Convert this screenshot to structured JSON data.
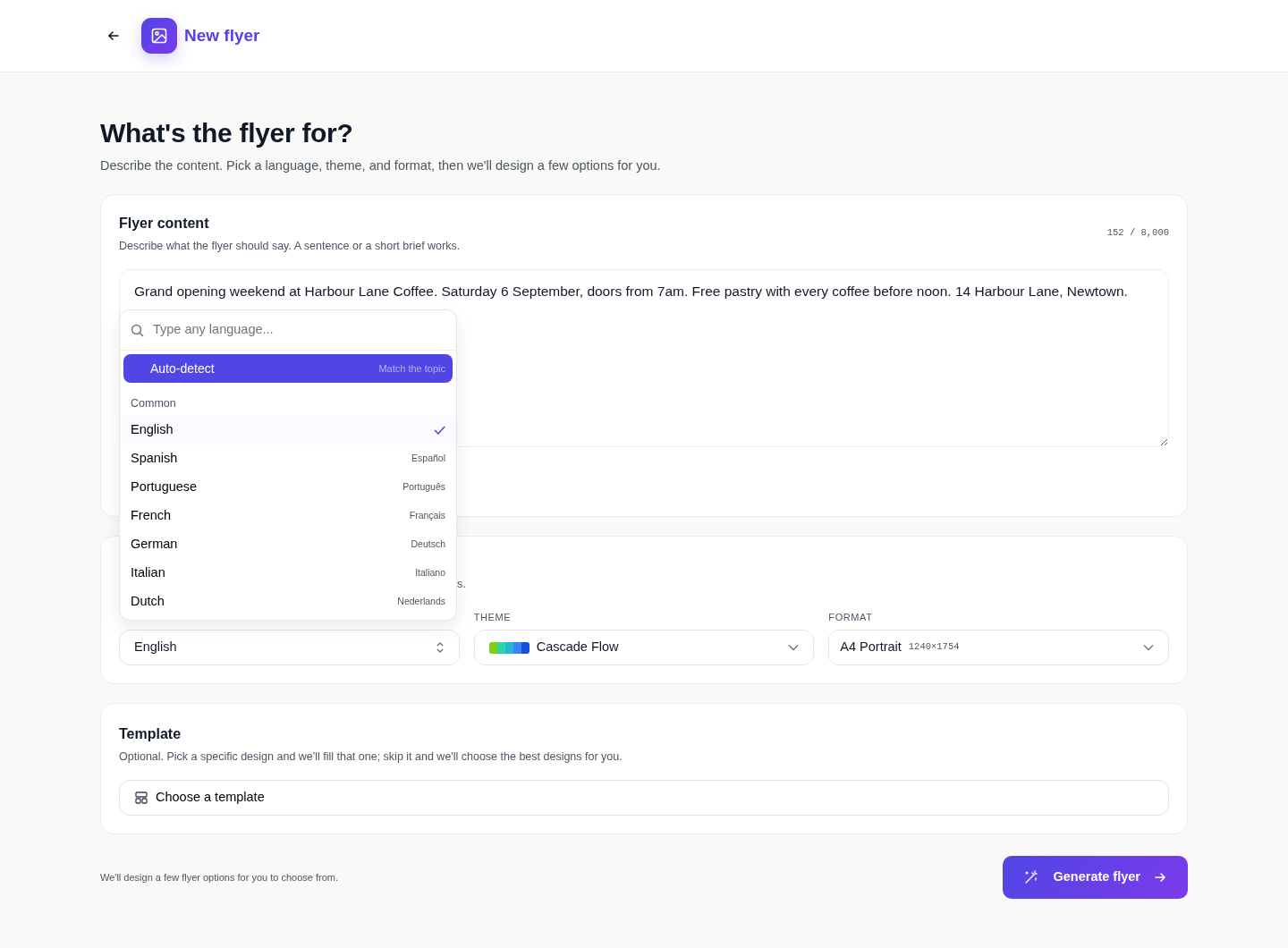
{
  "header": {
    "title": "New flyer"
  },
  "page": {
    "title": "What's the flyer for?",
    "subtitle": "Describe the content. Pick a language, theme, and format, then we'll design a few options for you."
  },
  "content_card": {
    "title": "Flyer content",
    "description": "Describe what the flyer should say. A sentence or a short brief works.",
    "counter": "152 / 8,000",
    "text": "Grand opening weekend at Harbour Lane Coffee. Saturday 6 September, doors from 7am. Free pastry with every coffee before noon. 14 Harbour Lane, Newtown."
  },
  "settings_card": {
    "description_fragment": "s.",
    "language": {
      "value": "English"
    },
    "theme": {
      "label": "THEME",
      "value": "Cascade Flow",
      "swatch": [
        {
          "color": "#84cc16"
        },
        {
          "color": "#2dd4a7"
        },
        {
          "color": "#22b8cf"
        },
        {
          "color": "#3b82f6"
        },
        {
          "color": "#1d4ed8"
        }
      ]
    },
    "format": {
      "label": "FORMAT",
      "value": "A4 Portrait",
      "size": "1240×1754"
    }
  },
  "language_menu": {
    "placeholder": "Type any language...",
    "auto": {
      "label": "Auto-detect",
      "hint": "Match the topic",
      "highlighted": true
    },
    "group": "Common",
    "items": [
      {
        "label": "English",
        "selected": true
      },
      {
        "label": "Spanish",
        "native": "Español",
        "selected": false
      },
      {
        "label": "Portuguese",
        "native": "Português",
        "selected": false
      },
      {
        "label": "French",
        "native": "Français",
        "selected": false
      },
      {
        "label": "German",
        "native": "Deutsch",
        "selected": false
      },
      {
        "label": "Italian",
        "native": "Italiano",
        "selected": false
      },
      {
        "label": "Dutch",
        "native": "Nederlands",
        "selected": false
      }
    ]
  },
  "template_card": {
    "title": "Template",
    "description": "Optional. Pick a specific design and we'll fill that one; skip it and we'll choose the best designs for you.",
    "button": "Choose a template"
  },
  "footer": {
    "note": "We'll design a few flyer options for you to choose from.",
    "button": "Generate flyer"
  }
}
